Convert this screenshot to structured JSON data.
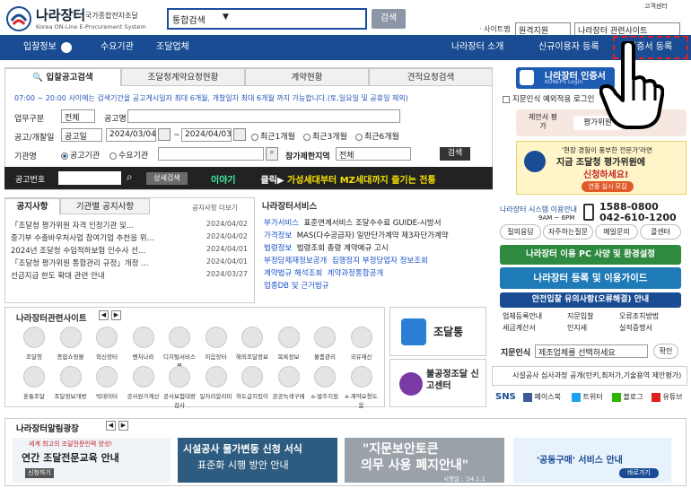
{
  "header": {
    "logo_title": "나라장터",
    "logo_sub": "국가종합전자조달",
    "logo_en": "Korea ON-Line E-Procurement System",
    "search_select": "통합검색",
    "search_button": "검색",
    "customer_center": "고객센터",
    "sitemap_label": "· 사이트맵",
    "sitemap_select": "원격지원",
    "related_select": "나라장터 관련사이트"
  },
  "nav": {
    "items": [
      "입찰정보",
      "수요기관",
      "조달업체"
    ],
    "right_items": [
      "나라장터 소개",
      "신규이용자 등록",
      "인증서 등록"
    ]
  },
  "search_tabs": [
    "입찰공고검색",
    "조달청계약요청현황",
    "계약현황",
    "견적요청검색"
  ],
  "search_note": "07:00 ~ 20:00 사이에는 검색기간을 공고게시일자 최대 6개월, 개찰일자 최대 6개월 까지 가능합니다.(토,일요일 및 공휴일 제외)",
  "form": {
    "biz_label": "업무구분",
    "biz_value": "전체",
    "notice_name_label": "공고명",
    "period_label": "공고/개찰일",
    "period_type": "공고일",
    "date_from": "2024/03/04",
    "date_to": "2024/04/03",
    "range_options": [
      "최근1개월",
      "최근3개월",
      "최근6개월"
    ],
    "agency_label": "기관명",
    "agency_options": [
      "공고기관",
      "수요기관"
    ],
    "region_label": "참가제한지역",
    "region_value": "전체",
    "search_btn": "검색",
    "bidno_label": "공고번호",
    "detail_btn": "상세검색"
  },
  "ticker": {
    "part1": "이야기",
    "part2": "클릭▶",
    "part3": "가성세대부터 MZ세대까지 즐기는 전통"
  },
  "notice_tabs": [
    "공지사항",
    "기관별 공지사항"
  ],
  "notice_more": "공지사항 더보기",
  "notices": [
    {
      "title": "「조달청 평가위원 자격 인정기관 및…",
      "date": "2024/04/02"
    },
    {
      "title": "중기부 수출바우처사업 참여기업 추천을 위…",
      "date": "2024/04/02"
    },
    {
      "title": "2024년 조달청 수입적하보험 인수사 선…",
      "date": "2024/04/01"
    },
    {
      "title": "「조달청 평가위원 통합관리 규정」개정 …",
      "date": "2024/04/01"
    },
    {
      "title": "선금지급 한도 확대 관련 안내",
      "date": "2024/03/27"
    }
  ],
  "services": {
    "title": "나라장터서비스",
    "rows": [
      {
        "k": "부가서비스",
        "v": "표준연계서비스  조달수수료  GUIDE-시방서"
      },
      {
        "k": "가격정보",
        "v": "MAS(다수공급자) 일반단가계약 제3자단가계약"
      },
      {
        "k": "법령정보",
        "v": "법령조회  총령  계약예규  고시"
      },
      {
        "k": "부정당제재정보공개",
        "v": "집행정지 부정당업자 정보조회"
      },
      {
        "k": "계약법규 해석조회",
        "v": "계약과정통합공개"
      },
      {
        "k": "업종DB 및 근거법규",
        "v": ""
      }
    ]
  },
  "related": {
    "title": "나라장터관련사이트",
    "row1": [
      "조달청",
      "종합쇼핑몰",
      "혁신장터",
      "벤처나라",
      "디지털서비스몰",
      "이음장터",
      "해외조달정보",
      "목록정보",
      "물품관리",
      "국유재산"
    ],
    "row2": [
      "혼통조달",
      "조달정보개방",
      "빅데이터",
      "공사원가계산",
      "공사보험대량검사",
      "일자리알리미",
      "하도급지킴이",
      "공공녹색구매",
      "e-발주지원",
      "e-계약요청도움"
    ]
  },
  "promo": {
    "jodaltong": "조달통",
    "unfair": "불공정조달 신고센터"
  },
  "right": {
    "cert_title": "나라장터 인증서",
    "cert_login": "KONEPS Login",
    "fingerprint": "지문인식 예외적용 로그인",
    "proposal": "제안서 평가",
    "evaluator": "평가위원",
    "banner_line1": "'현장 경험이 풍부한 전문가'라면",
    "banner_line2": "지금 조달청 평가위원에",
    "banner_line3": "신청하세요!",
    "banner_btn": "연중 실시 모집",
    "hours_title": "나라장터 시스템 이용안내",
    "hours": "9AM ~ 6PM",
    "tel1": "1588-0800",
    "tel2": "042-610-1200",
    "help": [
      "질의응답",
      "자주하는질문",
      "메일문의",
      "콜센터"
    ],
    "pc_setup": "나라장터 이용 PC 사양 및 환경설정",
    "register_guide": "나라장터 등록 및 이용가이드",
    "safe_bid": "안전입찰 유의사항(오류해결) 안내",
    "links": [
      "업체등록안내",
      "지문입찰",
      "오류조치방법",
      "세금계산서",
      "인지세",
      "실적증명서"
    ],
    "region_label": "지문인식",
    "region_select": "제조업체를 선택하세요",
    "confirm": "확인",
    "facility_notice": "시설공사 심사과정 공개(턴키,최저가,기술용역 제안평가)",
    "sns": "SNS",
    "sns_items": [
      "페이스북",
      "트위터",
      "블로그",
      "유튜브"
    ]
  },
  "bottom": {
    "title": "나라장터알림광장",
    "b1_title": "연간 조달전문교육 안내",
    "b1_sub": "세계 최고의 조달전문인력 양성!",
    "b1_btn": "신청하기",
    "b2_title": "시설공사 물가변동 신청 서식",
    "b2_sub": "표준화 시행 방안 안내",
    "b3_title": "\"지문보안토큰",
    "b3_sub": "의무 사용 폐지안내\"",
    "b3_date": "시행일 : '24.1.1",
    "b4_title": "'공동구매' 서비스 안내",
    "b4_btn": "바로가기"
  }
}
